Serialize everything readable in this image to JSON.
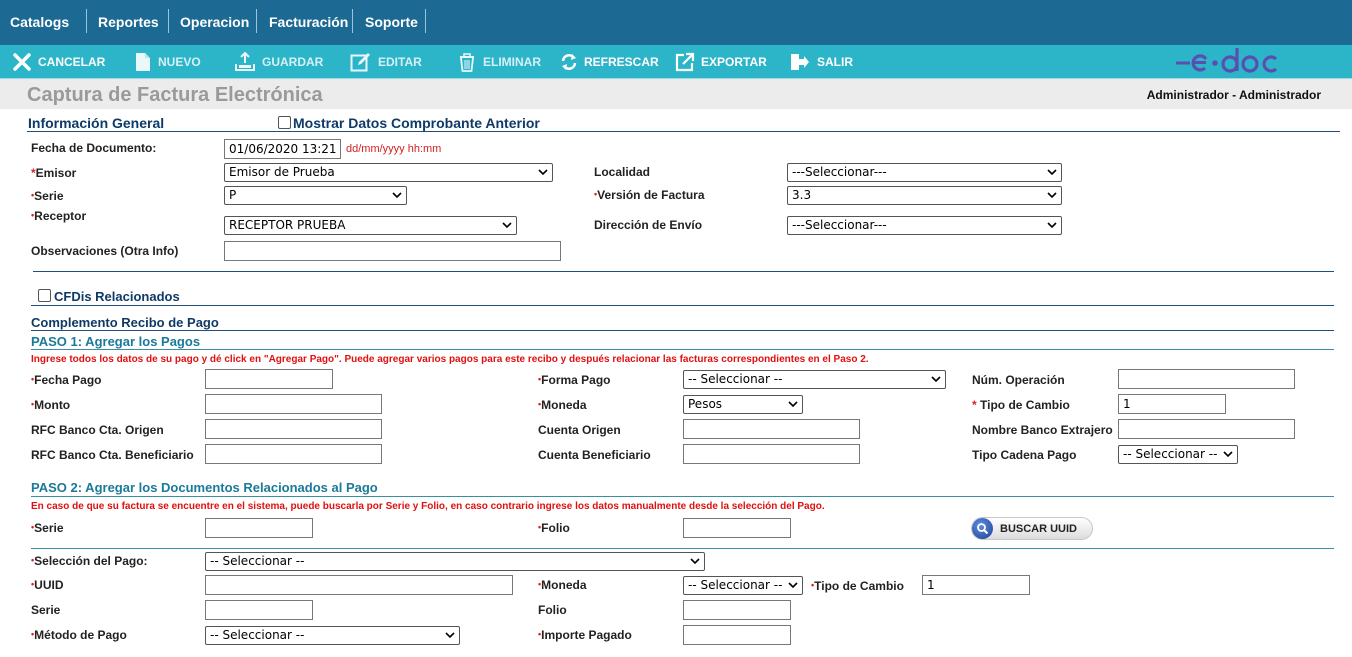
{
  "menu": [
    "Catalogs",
    "Reportes",
    "Operacion",
    "Facturación",
    "Soporte"
  ],
  "toolbar": {
    "cancelar": "CANCELAR",
    "nuevo": "NUEVO",
    "guardar": "GUARDAR",
    "editar": "EDITAR",
    "eliminar": "ELIMINAR",
    "refrescar": "REFRESCAR",
    "exportar": "EXPORTAR",
    "salir": "SALIR"
  },
  "logo_text": "e·doc",
  "page_title": "Captura de Factura Electrónica",
  "user": "Administrador - Administrador",
  "general": {
    "section_title": "Información General",
    "mostrar_label": "Mostrar Datos Comprobante Anterior",
    "fecha_label": "Fecha de Documento:",
    "fecha_value": "01/06/2020 13:21",
    "fecha_hint": "dd/mm/yyyy hh:mm",
    "emisor_label": "Emisor",
    "emisor_value": "Emisor de Prueba",
    "serie_label": "Serie",
    "serie_value": "P",
    "receptor_label": "Receptor",
    "receptor_value": "RECEPTOR PRUEBA",
    "observaciones_label": "Observaciones (Otra Info)",
    "observaciones_value": "",
    "localidad_label": "Localidad",
    "localidad_value": "---Seleccionar---",
    "version_label": "Versión de Factura",
    "version_value": "3.3",
    "direccion_label": "Dirección de Envío",
    "direccion_value": "---Seleccionar---"
  },
  "cfdis_label": "CFDis Relacionados",
  "complemento_title": "Complemento Recibo de Pago",
  "paso1": {
    "title": "PASO 1: Agregar los Pagos",
    "note": "Ingrese todos los datos de su pago y dé click en \"Agregar Pago\". Puede agregar varios pagos para este recibo y después relacionar las facturas correspondientes en el Paso 2.",
    "fecha_pago": "Fecha Pago",
    "monto": "Monto",
    "rfc_origen": "RFC Banco Cta. Origen",
    "rfc_beneficiario": "RFC Banco Cta. Beneficiario",
    "forma_pago": "Forma Pago",
    "forma_pago_value": "-- Seleccionar --",
    "moneda": "Moneda",
    "moneda_value": "Pesos",
    "cuenta_origen": "Cuenta Origen",
    "cuenta_beneficiario": "Cuenta Beneficiario",
    "num_operacion": "Núm. Operación",
    "tipo_cambio": "Tipo de Cambio",
    "tipo_cambio_value": "1",
    "nombre_banco": "Nombre Banco Extrajero",
    "tipo_cadena": "Tipo Cadena Pago",
    "tipo_cadena_value": "-- Seleccionar --"
  },
  "paso2": {
    "title": "PASO 2: Agregar los Documentos Relacionados al Pago",
    "note": "En caso de que su factura se encuentre en el sistema, puede buscarla por Serie y Folio, en caso contrario ingrese los datos manualmente desde la selección del Pago.",
    "serie": "Serie",
    "folio": "Folio",
    "buscar": "BUSCAR UUID",
    "seleccion_pago": "Selección del Pago:",
    "seleccion_pago_value": "-- Seleccionar --",
    "uuid": "UUID",
    "moneda": "Moneda",
    "moneda_value": "-- Seleccionar --",
    "tipo_cambio": "Tipo de Cambio",
    "tipo_cambio_value": "1",
    "serie2": "Serie",
    "folio2": "Folio",
    "metodo_pago": "Método de Pago",
    "metodo_pago_value": "-- Seleccionar --",
    "importe_pagado": "Importe Pagado"
  },
  "colors": {
    "menubar": "#1c6a93",
    "toolbar": "#2cb4c9",
    "section_title": "#0f3a66",
    "step_title": "#1a7a99",
    "required": "#e02020",
    "logo": "#5a4fb0"
  }
}
